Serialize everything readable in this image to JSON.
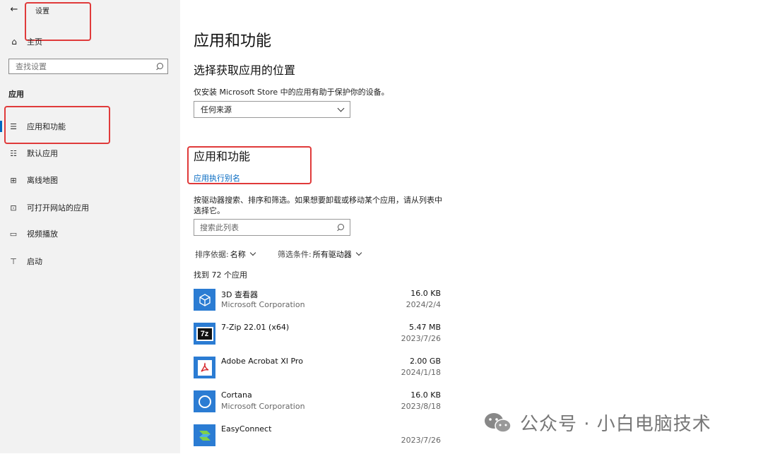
{
  "window": {
    "title": "设置"
  },
  "sidebar": {
    "home_label": "主页",
    "search_placeholder": "查找设置",
    "section_title": "应用",
    "items": [
      {
        "label": "应用和功能",
        "icon": "apps-list-icon",
        "active": true
      },
      {
        "label": "默认应用",
        "icon": "default-apps-icon",
        "active": false
      },
      {
        "label": "离线地图",
        "icon": "offline-map-icon",
        "active": false
      },
      {
        "label": "可打开网站的应用",
        "icon": "website-apps-icon",
        "active": false
      },
      {
        "label": "视频播放",
        "icon": "video-playback-icon",
        "active": false
      },
      {
        "label": "启动",
        "icon": "startup-icon",
        "active": false
      }
    ]
  },
  "main": {
    "page_title": "应用和功能",
    "install_section": {
      "title": "选择获取应用的位置",
      "description": "仅安装 Microsoft Store 中的应用有助于保护你的设备。",
      "dropdown_value": "任何来源"
    },
    "apps_section": {
      "title": "应用和功能",
      "alias_link": "应用执行别名",
      "description_line1": "按驱动器搜索、排序和筛选。如果想要卸载或移动某个应用，请从列表中",
      "description_line2": "选择它。",
      "search_placeholder": "搜索此列表",
      "sort_label": "排序依据:",
      "sort_value": "名称",
      "filter_label": "筛选条件:",
      "filter_value": "所有驱动器",
      "count_text": "找到 72 个应用"
    },
    "apps": [
      {
        "name": "3D 查看器",
        "publisher": "Microsoft Corporation",
        "size": "16.0 KB",
        "date": "2024/2/4",
        "icon": "3d-viewer-icon",
        "icon_color": "#2b7cd3"
      },
      {
        "name": "7-Zip 22.01 (x64)",
        "publisher": "",
        "size": "5.47 MB",
        "date": "2023/7/26",
        "icon": "7zip-icon",
        "icon_color": "#2b7cd3"
      },
      {
        "name": "Adobe Acrobat XI Pro",
        "publisher": "",
        "size": "2.00 GB",
        "date": "2024/1/18",
        "icon": "acrobat-icon",
        "icon_color": "#2b7cd3"
      },
      {
        "name": "Cortana",
        "publisher": "Microsoft Corporation",
        "size": "16.0 KB",
        "date": "2023/8/18",
        "icon": "cortana-icon",
        "icon_color": "#2b7cd3"
      },
      {
        "name": "EasyConnect",
        "publisher": "",
        "size": "",
        "date": "2023/7/26",
        "icon": "easyconnect-icon",
        "icon_color": "#2b7cd3"
      }
    ]
  },
  "watermark": {
    "text": "公众号 · 小白电脑技术"
  }
}
